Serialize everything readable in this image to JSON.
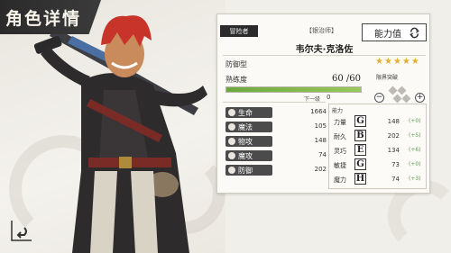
{
  "header": {
    "title": "角色详情"
  },
  "card": {
    "rank": "冒险者",
    "epithet": "【银治师】",
    "name": "韦尔夫·克洛佐",
    "ability_button": "能力值",
    "type": "防御型",
    "stars": 5,
    "proficiency_label": "熟练度",
    "proficiency_value": "60 /60",
    "proficiency_fraction": 1.0,
    "next_label": "下一级",
    "next_value": "0",
    "limit_label": "限界突破"
  },
  "stats": [
    {
      "label": "生命",
      "value": "1664",
      "icon": "heart-icon"
    },
    {
      "label": "魔法",
      "value": "105",
      "icon": "mana-icon"
    },
    {
      "label": "物攻",
      "value": "148",
      "icon": "sword-icon"
    },
    {
      "label": "魔攻",
      "value": "74",
      "icon": "magic-icon"
    },
    {
      "label": "防御",
      "value": "202",
      "icon": "shield-icon"
    }
  ],
  "abilities": {
    "title": "能力",
    "rows": [
      {
        "label": "力量",
        "grade": "G",
        "value": "148",
        "bonus": "(+0)"
      },
      {
        "label": "耐久",
        "grade": "B",
        "value": "202",
        "bonus": "(+5)"
      },
      {
        "label": "灵巧",
        "grade": "E",
        "value": "134",
        "bonus": "(+6)"
      },
      {
        "label": "敏捷",
        "grade": "G",
        "value": "73",
        "bonus": "(+0)"
      },
      {
        "label": "魔力",
        "grade": "H",
        "value": "74",
        "bonus": "(+3)"
      }
    ]
  },
  "colors": {
    "accent_dark": "#2b2b2b",
    "star": "#e1b12c",
    "bar_fill": "#6da83f",
    "bonus": "#59a24a"
  }
}
